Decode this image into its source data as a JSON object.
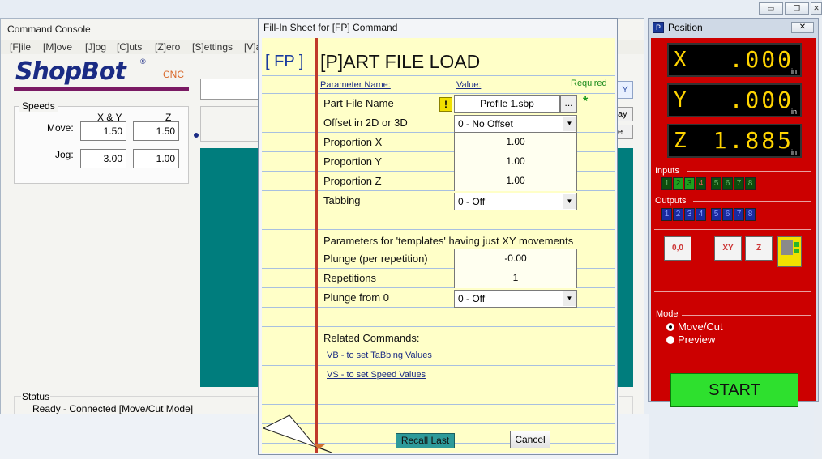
{
  "window_controls": {
    "minimize": "▭",
    "restore": "❐",
    "close": "✕"
  },
  "console": {
    "title": "Command Console",
    "menu": [
      "[F]ile",
      "[M]ove",
      "[J]og",
      "[C]uts",
      "[Z]ero",
      "[S]ettings",
      "[V]a"
    ],
    "logo": {
      "brand": "ShopBot",
      "registered": "®",
      "suffix": "CNC"
    },
    "speeds": {
      "legend": "Speeds",
      "col_xy": "X & Y",
      "col_z": "Z",
      "move_label": "Move:",
      "jog_label": "Jog:",
      "move_xy": "1.50",
      "move_z": "1.50",
      "jog_xy": "3.00",
      "jog_z": "1.00"
    },
    "side_buttons": [
      "Y",
      "ay",
      "e"
    ],
    "status": {
      "legend": "Status",
      "text": "Ready - Connected  [Move/Cut Mode]"
    }
  },
  "dialog": {
    "title": "Fill-In Sheet for [FP] Command",
    "code": "[ FP  ]",
    "heading": "[P]ART FILE LOAD",
    "col_param": "Parameter Name:",
    "col_value": "Value:",
    "col_required": "Required",
    "warn_glyph": "!",
    "browse_label": "...",
    "required_star": "*",
    "params": [
      {
        "name": "Part File Name",
        "value": "Profile 1.sbp"
      },
      {
        "name": "Offset in 2D or 3D",
        "value": "0 - No Offset"
      },
      {
        "name": "Proportion X",
        "value": "1.00"
      },
      {
        "name": "Proportion Y",
        "value": "1.00"
      },
      {
        "name": "Proportion Z",
        "value": "1.00"
      },
      {
        "name": "Tabbing",
        "value": "0 - Off"
      }
    ],
    "template_section": "Parameters for 'templates' having just XY movements",
    "template_params": [
      {
        "name": "Plunge (per repetition)",
        "value": "-0.00"
      },
      {
        "name": "Repetitions",
        "value": "1"
      },
      {
        "name": "Plunge from 0",
        "value": "0 - Off"
      }
    ],
    "related_heading": "Related Commands:",
    "related_links": [
      "VB - to set TaBbing Values",
      "VS - to set Speed Values"
    ],
    "recall_button": "Recall Last",
    "cancel_button": "Cancel"
  },
  "position": {
    "title": "Position",
    "axes": [
      {
        "axis": "X",
        "value": ".000",
        "unit": "in"
      },
      {
        "axis": "Y",
        "value": ".000",
        "unit": "in"
      },
      {
        "axis": "Z",
        "value": "1.885",
        "unit": "in"
      }
    ],
    "inputs_label": "Inputs",
    "inputs": [
      "1",
      "2",
      "3",
      "4",
      "5",
      "6",
      "7",
      "8"
    ],
    "outputs_label": "Outputs",
    "outputs": [
      "1",
      "2",
      "3",
      "4",
      "5",
      "6",
      "7",
      "8"
    ],
    "tool_buttons": [
      "0,0",
      "XY",
      "Z"
    ],
    "mode_label": "Mode",
    "mode_options": [
      "Move/Cut",
      "Preview"
    ],
    "start_button": "START"
  }
}
